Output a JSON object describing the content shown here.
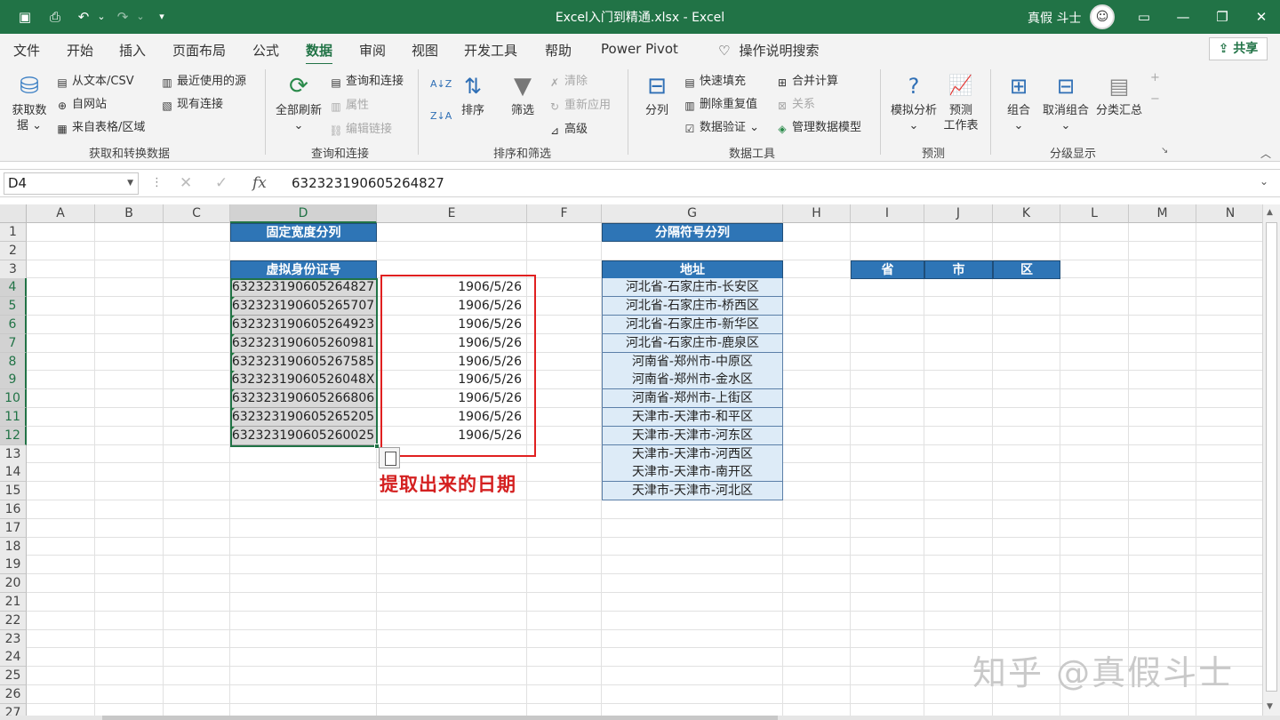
{
  "window": {
    "title": "Excel入门到精通.xlsx  -  Excel",
    "user_name": "真假 斗士",
    "avatar_glyph": "☺",
    "quick_access": [
      {
        "name": "save-icon",
        "glyph": "▣"
      },
      {
        "name": "print-preview-icon",
        "glyph": "⎙"
      },
      {
        "name": "undo-icon",
        "glyph": "↶"
      },
      {
        "name": "undo-dropdown-icon",
        "glyph": "⌄"
      },
      {
        "name": "redo-icon",
        "glyph": "↷"
      },
      {
        "name": "redo-dropdown-icon",
        "glyph": "⌄"
      },
      {
        "name": "customize-qat-icon",
        "glyph": "▾"
      }
    ],
    "controls": [
      {
        "name": "ribbon-display-options-icon",
        "glyph": "▭"
      },
      {
        "name": "minimize-icon",
        "glyph": "—"
      },
      {
        "name": "restore-icon",
        "glyph": "❐"
      },
      {
        "name": "close-icon",
        "glyph": "✕"
      }
    ]
  },
  "tabs": [
    {
      "label": "文件",
      "active": false
    },
    {
      "label": "开始",
      "active": false
    },
    {
      "label": "插入",
      "active": false
    },
    {
      "label": "页面布局",
      "active": false
    },
    {
      "label": "公式",
      "active": false
    },
    {
      "label": "数据",
      "active": true
    },
    {
      "label": "审阅",
      "active": false
    },
    {
      "label": "视图",
      "active": false
    },
    {
      "label": "开发工具",
      "active": false
    },
    {
      "label": "帮助",
      "active": false
    },
    {
      "label": "Power Pivot",
      "active": false
    }
  ],
  "tell_me": {
    "icon": "lightbulb-icon",
    "glyph": "♡",
    "label": "操作说明搜索"
  },
  "share_label": "共享",
  "share_glyph": "⇪",
  "ribbon": {
    "get_data": {
      "label_line1": "获取数",
      "label_line2": "据 ⌄",
      "glyph": "⛁"
    },
    "from_text_csv": {
      "glyph": "▤",
      "label": "从文本/CSV"
    },
    "from_web": {
      "glyph": "⊕",
      "label": "自网站"
    },
    "from_table": {
      "glyph": "▦",
      "label": "来自表格/区域"
    },
    "recent_sources": {
      "glyph": "▥",
      "label": "最近使用的源"
    },
    "existing_connections": {
      "glyph": "▧",
      "label": "现有连接"
    },
    "group_get_transform": "获取和转换数据",
    "refresh_all": {
      "label_line1": "全部刷新",
      "label_line2": "⌄",
      "glyph": "⟳"
    },
    "queries_connections": {
      "glyph": "▤",
      "label": "查询和连接"
    },
    "properties": {
      "glyph": "▥",
      "label": "属性"
    },
    "edit_links": {
      "glyph": "⛓",
      "label": "编辑链接"
    },
    "group_queries": "查询和连接",
    "sort_az": {
      "glyph": "A↓Z"
    },
    "sort_za": {
      "glyph": "Z↓A"
    },
    "sort": {
      "label": "排序",
      "glyph": "⇅"
    },
    "filter": {
      "label": "筛选",
      "glyph": "▼"
    },
    "clear": {
      "glyph": "✗",
      "label": "清除"
    },
    "reapply": {
      "glyph": "↻",
      "label": "重新应用"
    },
    "advanced": {
      "glyph": "⊿",
      "label": "高级"
    },
    "group_sort_filter": "排序和筛选",
    "text_to_columns": {
      "label": "分列",
      "glyph": "⊟"
    },
    "flash_fill": {
      "glyph": "▤",
      "label": "快速填充"
    },
    "remove_duplicates": {
      "glyph": "▥",
      "label": "删除重复值"
    },
    "data_validation": {
      "glyph": "☑",
      "label": "数据验证"
    },
    "data_validation_dd": "⌄",
    "consolidate": {
      "glyph": "⊞",
      "label": "合并计算"
    },
    "relationships": {
      "glyph": "⊠",
      "label": "关系"
    },
    "data_model": {
      "glyph": "◈",
      "label": "管理数据模型"
    },
    "group_data_tools": "数据工具",
    "what_if": {
      "label_line1": "模拟分析",
      "label_line2": "⌄",
      "glyph": "?"
    },
    "forecast_sheet": {
      "label_line1": "预测",
      "label_line2": "工作表",
      "glyph": "📈"
    },
    "group_forecast": "预测",
    "group": {
      "label_line1": "组合",
      "label_line2": "⌄",
      "glyph": "⊞"
    },
    "ungroup": {
      "label_line1": "取消组合",
      "label_line2": "⌄",
      "glyph": "⊟"
    },
    "subtotal": {
      "label": "分类汇总",
      "glyph": "▤"
    },
    "show_detail": {
      "glyph": "+"
    },
    "hide_detail": {
      "glyph": "−"
    },
    "group_outline": "分级显示",
    "launcher_glyph": "↘",
    "collapse_glyph": "︿"
  },
  "formula_bar": {
    "name_box": "D4",
    "name_dd": "▼",
    "more_glyph": "⋮",
    "cancel_glyph": "✕",
    "enter_glyph": "✓",
    "fx_glyph": "fx",
    "value": "632323190605264827",
    "expand_glyph": "⌄"
  },
  "sheet": {
    "columns": [
      "A",
      "B",
      "C",
      "D",
      "E",
      "F",
      "G",
      "H",
      "I",
      "J",
      "K",
      "L",
      "M",
      "N"
    ],
    "selected_column": "D",
    "rows": [
      "1",
      "2",
      "3",
      "4",
      "5",
      "6",
      "7",
      "8",
      "9",
      "10",
      "11",
      "12",
      "13",
      "14",
      "15",
      "16",
      "17",
      "18",
      "19",
      "20",
      "21",
      "22",
      "23",
      "24",
      "25",
      "26",
      "27"
    ],
    "selected_rows": [
      "4",
      "5",
      "6",
      "7",
      "8",
      "9",
      "10",
      "11",
      "12"
    ],
    "d1_header": "固定宽度分列",
    "d3_header": "虚拟身份证号",
    "ids": [
      "632323190605264827",
      "632323190605265707",
      "632323190605264923",
      "632323190605260981",
      "632323190605267585",
      "63232319060526048X",
      "632323190605266806",
      "632323190605265205",
      "632323190605260025"
    ],
    "dates": [
      "1906/5/26",
      "1906/5/26",
      "1906/5/26",
      "1906/5/26",
      "1906/5/26",
      "1906/5/26",
      "1906/5/26",
      "1906/5/26",
      "1906/5/26"
    ],
    "g1_header": "分隔符号分列",
    "g3_header": "地址",
    "addresses": [
      "河北省-石家庄市-长安区",
      "河北省-石家庄市-桥西区",
      "河北省-石家庄市-新华区",
      "河北省-石家庄市-鹿泉区",
      "河南省-郑州市-中原区",
      "河南省-郑州市-金水区",
      "河南省-郑州市-上街区",
      "天津市-天津市-和平区",
      "天津市-天津市-河东区",
      "天津市-天津市-河西区",
      "天津市-天津市-南开区",
      "天津市-天津市-河北区"
    ],
    "i3": "省",
    "j3": "市",
    "k3": "区"
  },
  "annotation": "提取出来的日期",
  "watermark": "知乎 @真假斗士",
  "scroll": {
    "up_glyph": "▲",
    "down_glyph": "▼"
  },
  "colors": {
    "excel_green": "#217346",
    "header_blue": "#2e75b6",
    "address_fill": "#ddebf7",
    "annotation_red": "#e02020"
  }
}
